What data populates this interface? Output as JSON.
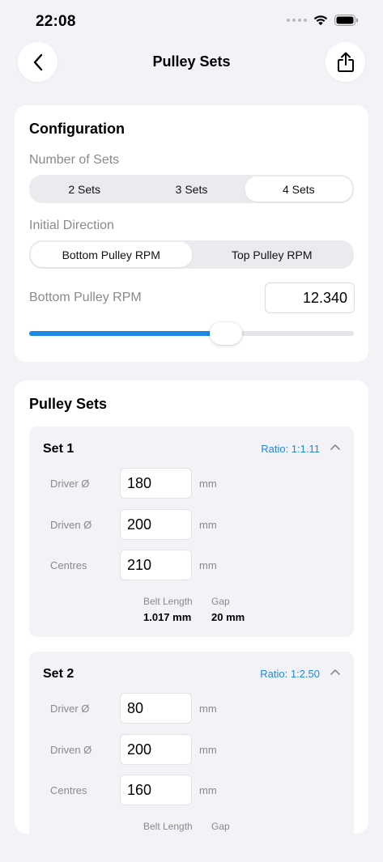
{
  "status": {
    "time": "22:08"
  },
  "nav": {
    "title": "Pulley Sets"
  },
  "config": {
    "title": "Configuration",
    "sets_label": "Number of Sets",
    "sets_options": [
      "2 Sets",
      "3 Sets",
      "4 Sets"
    ],
    "sets_selected": "4 Sets",
    "direction_label": "Initial Direction",
    "direction_options": [
      "Bottom Pulley RPM",
      "Top Pulley RPM"
    ],
    "direction_selected": "Bottom Pulley RPM",
    "rpm_label": "Bottom Pulley RPM",
    "rpm_value": "12.340",
    "slider_fraction": 0.605,
    "accent_color": "#1e88e5"
  },
  "sets": {
    "title": "Pulley Sets",
    "items": [
      {
        "name": "Set 1",
        "ratio": "Ratio: 1:1.11",
        "driver_label": "Driver Ø",
        "driver": "180",
        "driven_label": "Driven Ø",
        "driven": "200",
        "centres_label": "Centres",
        "centres": "210",
        "unit": "mm",
        "belt_label": "Belt Length",
        "belt": "1.017 mm",
        "gap_label": "Gap",
        "gap": "20 mm"
      },
      {
        "name": "Set 2",
        "ratio": "Ratio: 1:2.50",
        "driver_label": "Driver Ø",
        "driver": "80",
        "driven_label": "Driven Ø",
        "driven": "200",
        "centres_label": "Centres",
        "centres": "160",
        "unit": "mm",
        "belt_label": "Belt Length",
        "belt": "",
        "gap_label": "Gap",
        "gap": ""
      }
    ]
  }
}
